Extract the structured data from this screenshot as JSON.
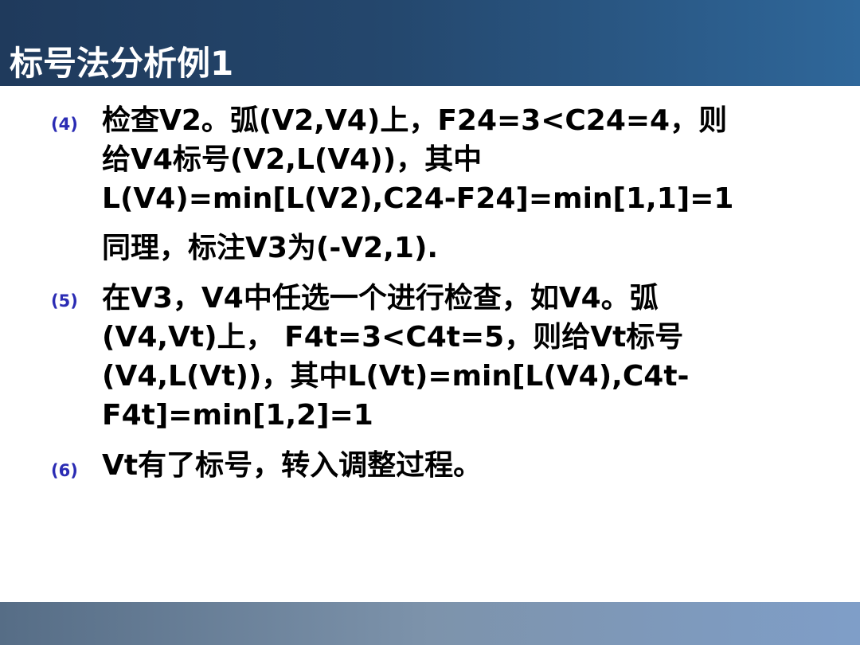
{
  "slide": {
    "title": "标号法分析例1",
    "items": [
      {
        "marker": "(4)",
        "lines": [
          "检查V2。弧(V2,V4)上，F24=3<C24=4，则",
          "给V4标号(V2,L(V4))，其中",
          "L(V4)=min[L(V2),C24-F24]=min[1,1]=1",
          "同理，标注V3为(-V2,1)."
        ]
      },
      {
        "marker": "(5)",
        "lines": [
          "在V3，V4中任选一个进行检查，如V4。弧",
          "(V4,Vt)上， F4t=3<C4t=5，则给Vt标号",
          "(V4,L(Vt))，其中L(Vt)=min[L(V4),C4t-",
          "F4t]=min[1,2]=1"
        ]
      },
      {
        "marker": "(6)",
        "lines": [
          "Vt有了标号，转入调整过程。"
        ]
      }
    ]
  }
}
